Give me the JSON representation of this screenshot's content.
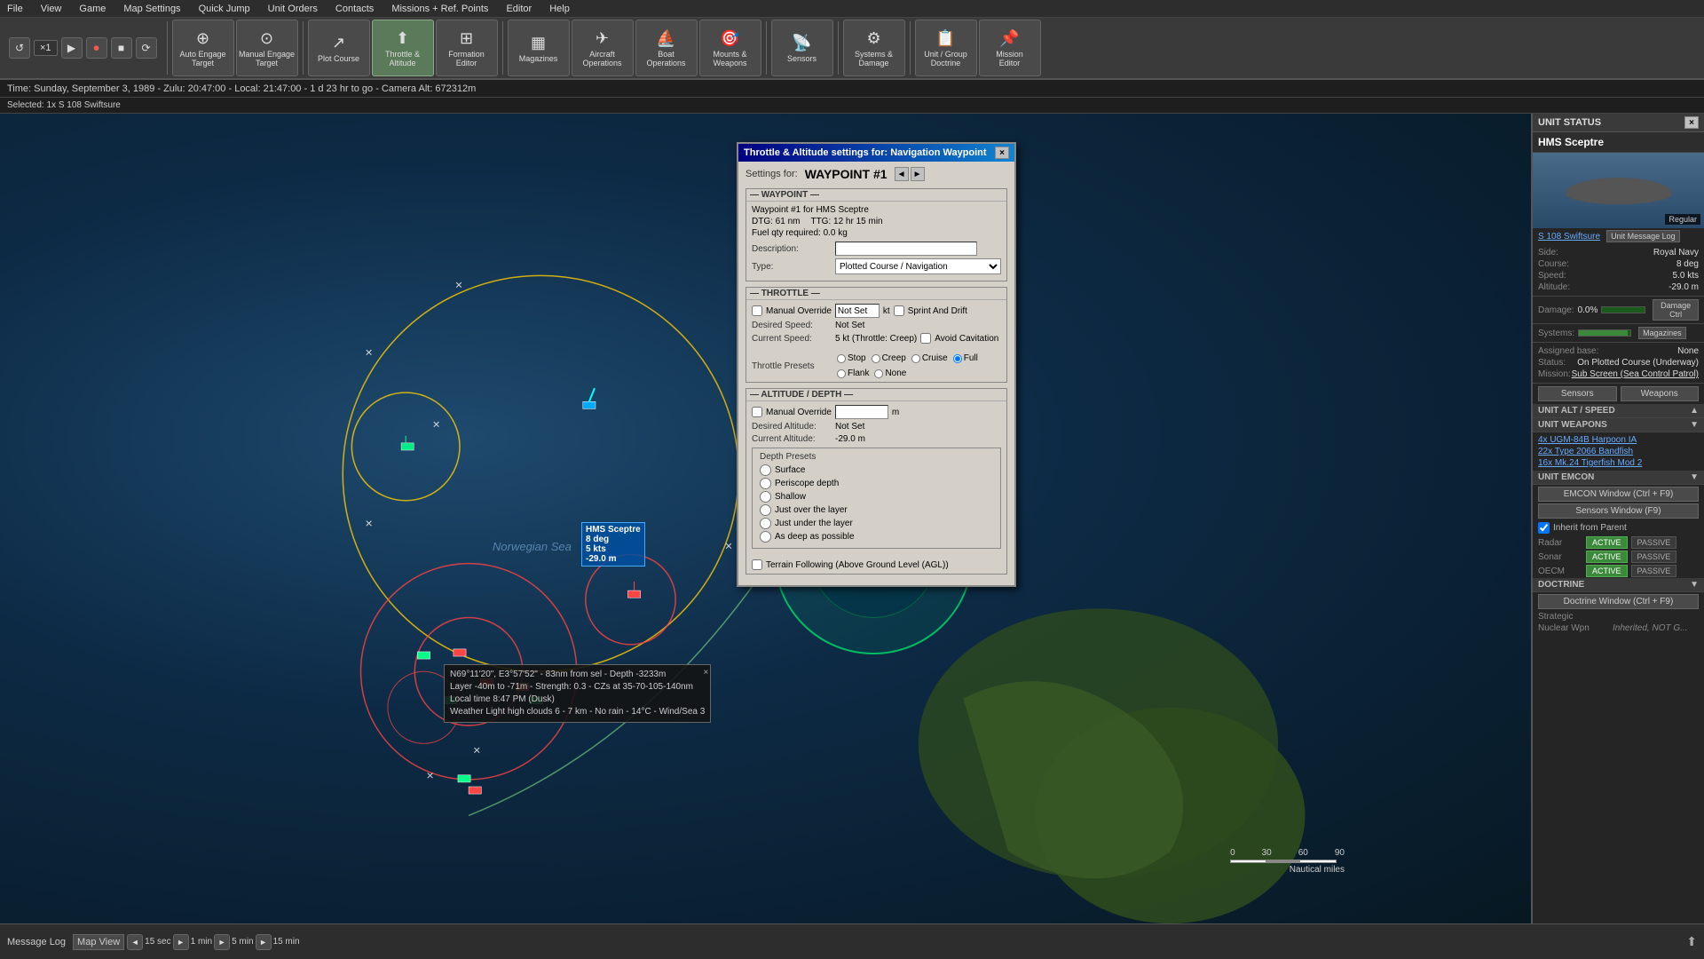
{
  "menubar": {
    "items": [
      "File",
      "View",
      "Game",
      "Map Settings",
      "Quick Jump",
      "Unit Orders",
      "Contacts",
      "Missions + Ref. Points",
      "Editor",
      "Help"
    ]
  },
  "toolbar": {
    "buttons": [
      {
        "id": "auto-engage",
        "icon": "⊕",
        "label": "Auto Engage\nTarget"
      },
      {
        "id": "manual-engage",
        "icon": "⊙",
        "label": "Manual Engage\nTarget"
      },
      {
        "id": "plot-course",
        "icon": "↗",
        "label": "Plot Course"
      },
      {
        "id": "throttle-altitude",
        "icon": "⬆",
        "label": "Throttle &\nAltitude"
      },
      {
        "id": "formation-editor",
        "icon": "⊞",
        "label": "Formation\nEditor"
      },
      {
        "id": "magazines",
        "icon": "▦",
        "label": "Magazines"
      },
      {
        "id": "aircraft-ops",
        "icon": "✈",
        "label": "Aircraft\nOperations"
      },
      {
        "id": "boat-ops",
        "icon": "⛵",
        "label": "Boat\nOperations"
      },
      {
        "id": "mounts-weapons",
        "icon": "🎯",
        "label": "Mounts &\nWeapons"
      },
      {
        "id": "sensors",
        "icon": "📡",
        "label": "Sensors"
      },
      {
        "id": "systems-damage",
        "icon": "⚙",
        "label": "Systems &\nDamage"
      },
      {
        "id": "unit-group-doctrine",
        "icon": "📋",
        "label": "Unit / Group\nDoctrine"
      },
      {
        "id": "mission-editor",
        "icon": "📌",
        "label": "Mission\nEditor"
      }
    ]
  },
  "playback": {
    "multiplier": "×1"
  },
  "status": {
    "time": "Time: Sunday, September 3, 1989 - Zulu: 20:47:00 - Local: 21:47:00 - 1 d 23 hr to go  -  Camera Alt: 672312m",
    "selected_label": "Selected:",
    "selected_unit": "1x S 108 Swiftsure"
  },
  "map": {
    "sea_label": "Norwegian Sea",
    "tooltip": {
      "line1": "N69°11'20\", E3°57'52\" - 83nm from sel - Depth -3233m",
      "line2": "Layer -40m to -71m - Strength: 0.3 - CZs at 35-70-105-140nm",
      "line3": "Local time 8:47 PM (Dusk)",
      "line4": "Weather Light high clouds 6 - 7 km - No rain - 14°C - Wind/Sea 3"
    },
    "unit_label": {
      "name": "HMS Sceptre",
      "course": "8 deg",
      "speed": "5 kts",
      "depth": "-29.0 m"
    }
  },
  "throttle_dialog": {
    "title": "Throttle & Altitude settings for: Navigation Waypoint",
    "settings_for": "Settings for:",
    "waypoint_name": "WAYPOINT #1",
    "waypoint_section": {
      "title": "WAYPOINT",
      "description_label": "Waypoint #1 for HMS Sceptre",
      "dtg": "DTG: 61 nm",
      "ttg": "TTG: 12 hr 15 min",
      "fuel": "Fuel qty required: 0.0 kg",
      "desc_label": "Description:",
      "type_label": "Type:",
      "type_value": "Plotted Course / Navigation"
    },
    "throttle_section": {
      "title": "THROTTLE",
      "manual_override_label": "Manual Override",
      "manual_override_checked": false,
      "not_set": "Not Set",
      "kt": "kt",
      "sprint_drift_label": "Sprint And Drift",
      "sprint_drift_checked": false,
      "desired_speed_label": "Desired Speed:",
      "desired_speed_val": "Not Set",
      "current_speed_label": "Current Speed:",
      "current_speed_val": "5 kt (Throttle: Creep)",
      "avoid_cav_label": "Avoid Cavitation",
      "avoid_cav_checked": false
    },
    "throttle_presets": {
      "title": "Throttle Presets",
      "options": [
        "Stop",
        "Creep",
        "Cruise",
        "Full",
        "Flank",
        "None"
      ],
      "selected": "Full"
    },
    "altitude_section": {
      "title": "ALTITUDE / DEPTH",
      "manual_override_label": "Manual Override",
      "manual_override_checked": false,
      "unit": "m",
      "desired_alt_label": "Desired Altitude:",
      "desired_alt_val": "Not Set",
      "current_alt_label": "Current Altitude:",
      "current_alt_val": "-29.0 m"
    },
    "depth_presets": {
      "title": "Depth Presets",
      "options": [
        "Surface",
        "Periscope depth",
        "Shallow",
        "Just over the layer",
        "Just under the layer",
        "As deep as possible"
      ]
    },
    "terrain_label": "Terrain Following (Above Ground Level (AGL))",
    "terrain_checked": false
  },
  "right_panel": {
    "title": "UNIT STATUS",
    "close": "×",
    "unit_name": "HMS Sceptre",
    "unit_link": "S 108 Swiftsure",
    "unit_msg_btn": "Unit Message Log",
    "regular_badge": "Regular",
    "details": {
      "side_label": "Side:",
      "side_val": "Royal Navy",
      "course_label": "Course:",
      "course_val": "8 deg",
      "speed_label": "Speed:",
      "speed_val": "5.0 kts",
      "altitude_label": "Altitude:",
      "altitude_val": "-29.0 m"
    },
    "damage": {
      "label": "Damage:",
      "value": "0.0%",
      "btn": "Damage Ctrl"
    },
    "systems": {
      "label": "Systems:",
      "btn": "Magazines"
    },
    "assigned_base": {
      "label": "Assigned base:",
      "value": "None"
    },
    "status": {
      "label": "Status:",
      "value": "On Plotted Course (Underway)"
    },
    "mission": {
      "label": "Mission:",
      "value": "Sub Screen (Sea Control Patrol)"
    },
    "sensors_btn": "Sensors",
    "weapons_btn": "Weapons",
    "unit_alt_speed": "UNIT ALT / SPEED",
    "unit_weapons": {
      "title": "UNIT WEAPONS",
      "items": [
        "4x UGM-84B Harpoon IA",
        "22x Type 2066 Bandfish",
        "16x Mk.24 Tigerfish Mod 2"
      ]
    },
    "unit_emcon": {
      "title": "UNIT EMCON",
      "emcon_btn": "EMCON Window (Ctrl + F9)",
      "sensors_btn": "Sensors Window (F9)",
      "inherit_label": "Inherit from Parent",
      "inherit_checked": true,
      "rows": [
        {
          "label": "Radar",
          "active": "ACTIVE",
          "passive": "PASSIVE"
        },
        {
          "label": "Sonar",
          "active": "ACTIVE",
          "passive": "PASSIVE"
        },
        {
          "label": "OECM",
          "active": "ACTIVE",
          "passive": "PASSIVE"
        }
      ]
    },
    "doctrine": {
      "title": "DOCTRINE",
      "btn": "Doctrine Window (Ctrl + F9)",
      "strategic_label": "Strategic",
      "nuclear_wpn_label": "Nuclear Wpn",
      "nuclear_wpn_val": "Inherited, NOT G..."
    },
    "scale": {
      "labels": [
        "0",
        "30",
        "60",
        "90"
      ],
      "unit": "Nautical miles"
    }
  },
  "bottom_bar": {
    "message_log": "Message Log",
    "map_view": "Map View",
    "time_steps": [
      "15 sec",
      "1 min",
      "5 min",
      "15 min"
    ],
    "upload_icon": "⬆"
  }
}
